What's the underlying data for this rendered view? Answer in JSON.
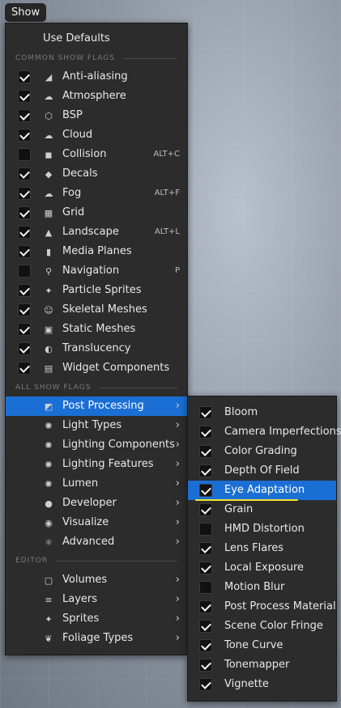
{
  "show_button": "Show",
  "use_defaults": "Use Defaults",
  "sections": {
    "common": "COMMON SHOW FLAGS",
    "all": "ALL SHOW FLAGS",
    "editor": "EDITOR"
  },
  "common_flags": [
    {
      "label": "Anti-aliasing",
      "checked": true,
      "shortcut": "",
      "icon": "anti-aliasing-icon"
    },
    {
      "label": "Atmosphere",
      "checked": true,
      "shortcut": "",
      "icon": "atmosphere-icon"
    },
    {
      "label": "BSP",
      "checked": true,
      "shortcut": "",
      "icon": "bsp-icon"
    },
    {
      "label": "Cloud",
      "checked": true,
      "shortcut": "",
      "icon": "cloud-icon"
    },
    {
      "label": "Collision",
      "checked": false,
      "shortcut": "ALT+C",
      "icon": "collision-icon"
    },
    {
      "label": "Decals",
      "checked": true,
      "shortcut": "",
      "icon": "decals-icon"
    },
    {
      "label": "Fog",
      "checked": true,
      "shortcut": "ALT+F",
      "icon": "fog-icon"
    },
    {
      "label": "Grid",
      "checked": true,
      "shortcut": "",
      "icon": "grid-icon"
    },
    {
      "label": "Landscape",
      "checked": true,
      "shortcut": "ALT+L",
      "icon": "landscape-icon"
    },
    {
      "label": "Media Planes",
      "checked": true,
      "shortcut": "",
      "icon": "media-planes-icon"
    },
    {
      "label": "Navigation",
      "checked": false,
      "shortcut": "P",
      "icon": "navigation-icon"
    },
    {
      "label": "Particle Sprites",
      "checked": true,
      "shortcut": "",
      "icon": "particle-sprites-icon"
    },
    {
      "label": "Skeletal Meshes",
      "checked": true,
      "shortcut": "",
      "icon": "skeletal-meshes-icon"
    },
    {
      "label": "Static Meshes",
      "checked": true,
      "shortcut": "",
      "icon": "static-meshes-icon"
    },
    {
      "label": "Translucency",
      "checked": true,
      "shortcut": "",
      "icon": "translucency-icon"
    },
    {
      "label": "Widget Components",
      "checked": true,
      "shortcut": "",
      "icon": "widget-components-icon"
    }
  ],
  "all_flags": [
    {
      "label": "Post Processing",
      "icon": "post-processing-icon",
      "active": true
    },
    {
      "label": "Light Types",
      "icon": "light-types-icon",
      "active": false
    },
    {
      "label": "Lighting Components",
      "icon": "lighting-components-icon",
      "active": false
    },
    {
      "label": "Lighting Features",
      "icon": "lighting-features-icon",
      "active": false
    },
    {
      "label": "Lumen",
      "icon": "lumen-icon",
      "active": false
    },
    {
      "label": "Developer",
      "icon": "developer-icon",
      "active": false
    },
    {
      "label": "Visualize",
      "icon": "visualize-icon",
      "active": false
    },
    {
      "label": "Advanced",
      "icon": "advanced-icon",
      "active": false
    }
  ],
  "editor_flags": [
    {
      "label": "Volumes",
      "icon": "volumes-icon"
    },
    {
      "label": "Layers",
      "icon": "layers-icon"
    },
    {
      "label": "Sprites",
      "icon": "sprites-icon"
    },
    {
      "label": "Foliage Types",
      "icon": "foliage-types-icon"
    }
  ],
  "post_processing_flags": [
    {
      "label": "Bloom",
      "checked": true,
      "active": false
    },
    {
      "label": "Camera Imperfections",
      "checked": true,
      "active": false
    },
    {
      "label": "Color Grading",
      "checked": true,
      "active": false
    },
    {
      "label": "Depth Of Field",
      "checked": true,
      "active": false
    },
    {
      "label": "Eye Adaptation",
      "checked": true,
      "active": true
    },
    {
      "label": "Grain",
      "checked": true,
      "active": false
    },
    {
      "label": "HMD Distortion",
      "checked": false,
      "active": false
    },
    {
      "label": "Lens Flares",
      "checked": true,
      "active": false
    },
    {
      "label": "Local Exposure",
      "checked": true,
      "active": false
    },
    {
      "label": "Motion Blur",
      "checked": false,
      "active": false
    },
    {
      "label": "Post Process Material",
      "checked": true,
      "active": false
    },
    {
      "label": "Scene Color Fringe",
      "checked": true,
      "active": false
    },
    {
      "label": "Tone Curve",
      "checked": true,
      "active": false
    },
    {
      "label": "Tonemapper",
      "checked": true,
      "active": false
    },
    {
      "label": "Vignette",
      "checked": true,
      "active": false
    }
  ],
  "colors": {
    "highlight": "#1b6fd4",
    "menu_bg": "#2c2c2c",
    "annotation": "#f2e332"
  }
}
